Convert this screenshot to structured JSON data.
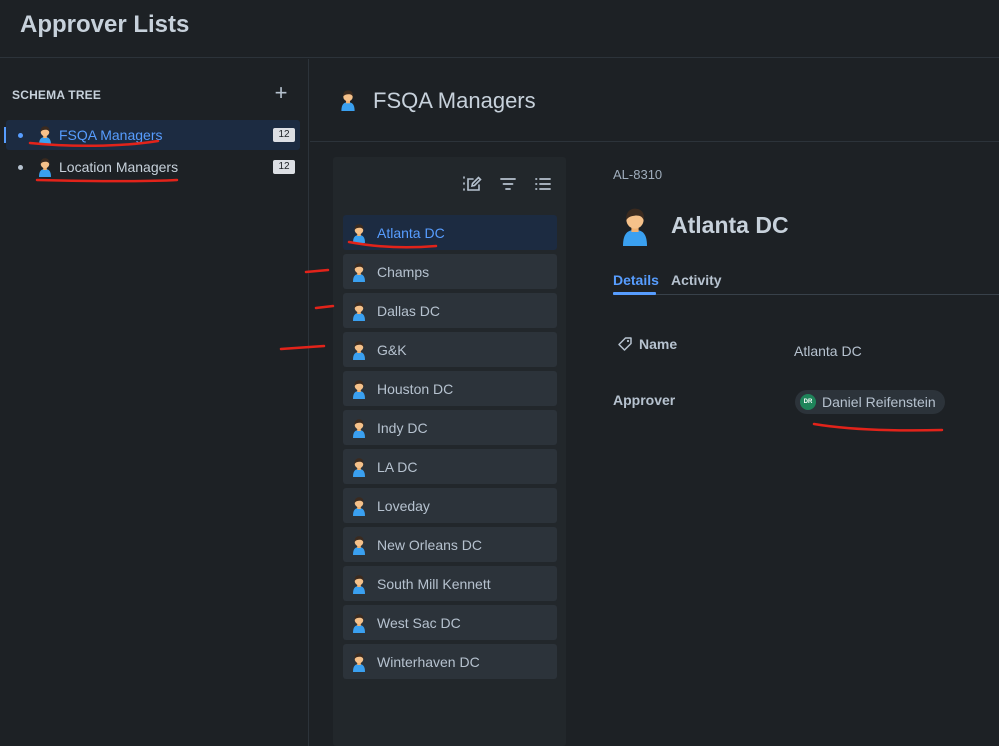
{
  "app": {
    "title": "Approver Lists"
  },
  "sidebar": {
    "section_label": "SCHEMA TREE",
    "add_icon": "plus-icon",
    "items": [
      {
        "label": "FSQA Managers",
        "count": "12",
        "selected": true,
        "icon": "person-icon"
      },
      {
        "label": "Location Managers",
        "count": "12",
        "selected": false,
        "icon": "person-icon"
      }
    ]
  },
  "main": {
    "header_title": "FSQA Managers",
    "header_icon": "person-icon"
  },
  "list": {
    "toolbar_icons": [
      "edit-list-icon",
      "filter-icon",
      "list-view-icon"
    ],
    "items": [
      {
        "label": "Atlanta DC",
        "selected": true
      },
      {
        "label": "Champs"
      },
      {
        "label": "Dallas DC"
      },
      {
        "label": "G&K"
      },
      {
        "label": "Houston DC"
      },
      {
        "label": "Indy DC"
      },
      {
        "label": "LA DC"
      },
      {
        "label": "Loveday"
      },
      {
        "label": "New Orleans DC"
      },
      {
        "label": "South Mill Kennett"
      },
      {
        "label": "West Sac DC"
      },
      {
        "label": "Winterhaven DC"
      }
    ]
  },
  "detail": {
    "key": "AL-8310",
    "title": "Atlanta DC",
    "tabs": [
      {
        "label": "Details",
        "active": true
      },
      {
        "label": "Activity",
        "active": false
      }
    ],
    "fields": {
      "name_label": "Name",
      "name_value": "Atlanta DC",
      "approver_label": "Approver",
      "approver_initials": "DR",
      "approver_name": "Daniel Reifenstein"
    }
  },
  "colors": {
    "background": "#1d2125",
    "accent": "#579dff",
    "annotation": "#e2231a",
    "avatar": "#1f845a"
  }
}
